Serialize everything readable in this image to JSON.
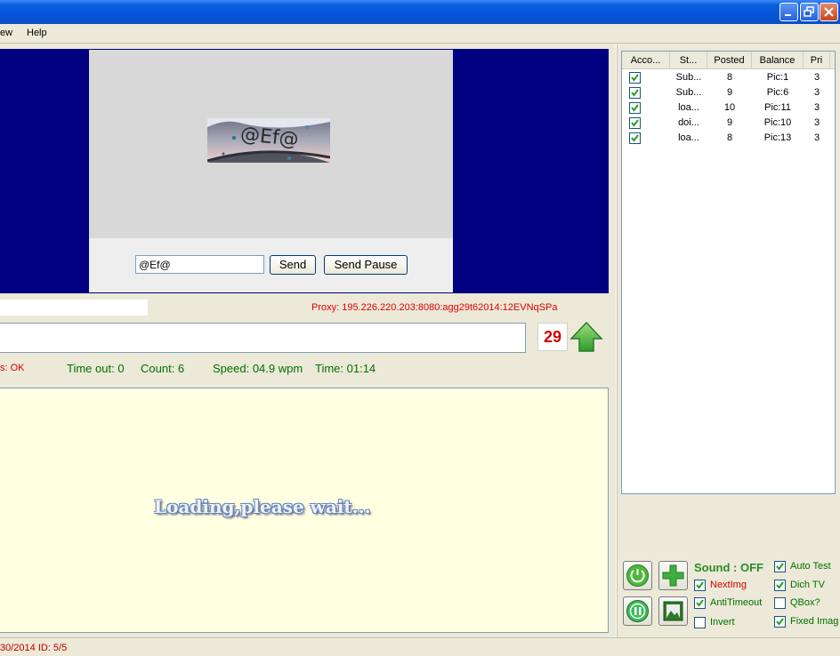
{
  "menu": {
    "view": "ew",
    "help": "Help"
  },
  "captcha": {
    "image_text": "@Ef@",
    "input_value": "@Ef@",
    "send_label": "Send",
    "send_pause_label": "Send Pause"
  },
  "proxy": "Proxy: 195.226.220.203:8080:agg29t62014:12EVNqSPa",
  "counter": "29",
  "status": {
    "ok": "s: OK",
    "timeout": "Time out: 0",
    "count": "Count: 6",
    "speed": "Speed: 04.9 wpm",
    "time": "Time: 01:14"
  },
  "log": {
    "loading": "Loading,please wait..."
  },
  "accounts": {
    "columns": [
      "Acco...",
      "St...",
      "Posted",
      "Balance",
      "Pri"
    ],
    "rows": [
      {
        "status": "Sub...",
        "posted": "8",
        "balance": "Pic:1",
        "pri": "3"
      },
      {
        "status": "Sub...",
        "posted": "9",
        "balance": "Pic:6",
        "pri": "3"
      },
      {
        "status": "loa...",
        "posted": "10",
        "balance": "Pic:11",
        "pri": "3"
      },
      {
        "status": "doi...",
        "posted": "9",
        "balance": "Pic:10",
        "pri": "3"
      },
      {
        "status": "loa...",
        "posted": "8",
        "balance": "Pic:13",
        "pri": "3"
      }
    ]
  },
  "controls": {
    "sound": "Sound : OFF",
    "next_img": "NextImg",
    "anti_timeout": "AntiTimeout",
    "invert": "Invert",
    "auto_test": "Auto Test",
    "dich_tv": "Dich TV",
    "qbox": "QBox?",
    "fixed_image": "Fixed Imag"
  },
  "statusbar": {
    "text": "30/2014  ID: 5/5"
  },
  "colors": {
    "navy": "#000080",
    "proxy_red": "#e00000",
    "status_green": "#007000",
    "log_bg": "#ffffe1"
  }
}
